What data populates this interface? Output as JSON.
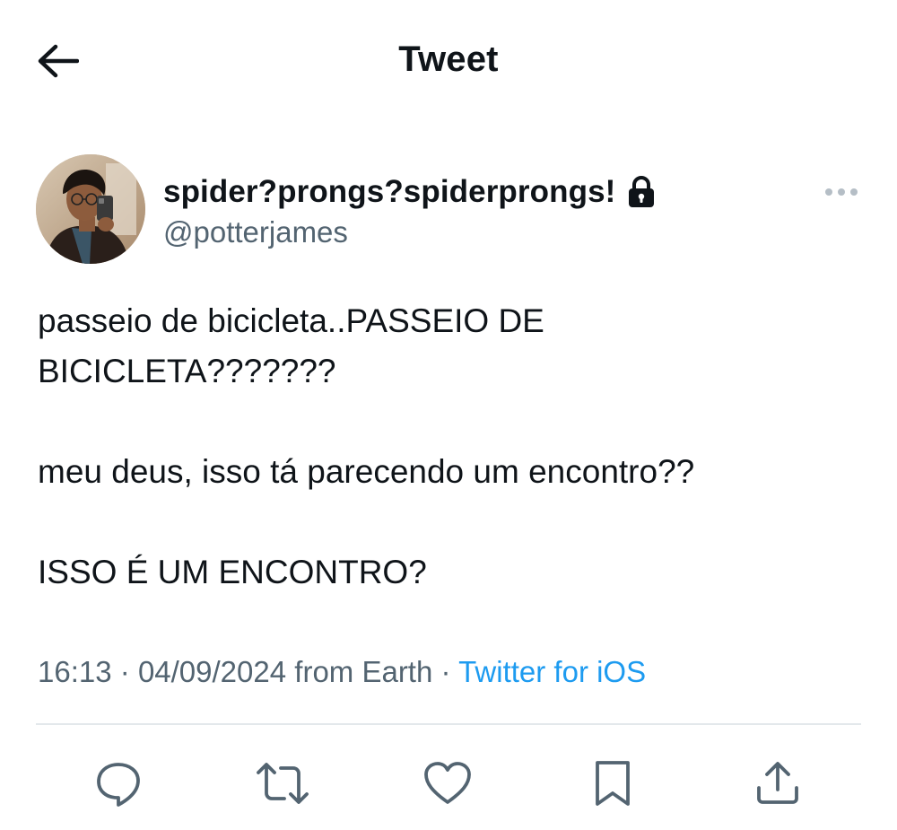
{
  "header": {
    "title": "Tweet",
    "back_icon": "arrow-left-icon"
  },
  "author": {
    "display_name": "spider?prongs?spiderprongs!",
    "handle": "@potterjames",
    "protected_icon": "lock-icon",
    "more_icon": "more-horizontal-icon"
  },
  "tweet": {
    "paragraphs": [
      "passeio de bicicleta..PASSEIO DE BICICLETA???????",
      "meu deus, isso tá parecendo um encontro??",
      "ISSO É UM ENCONTRO?"
    ]
  },
  "meta": {
    "time": "16:13",
    "separator": "·",
    "date": "04/09/2024",
    "location": "from Earth",
    "source": "Twitter for iOS"
  },
  "actions": {
    "reply_icon": "reply-icon",
    "retweet_icon": "retweet-icon",
    "like_icon": "heart-icon",
    "bookmark_icon": "bookmark-icon",
    "share_icon": "share-icon"
  },
  "colors": {
    "text": "#0f1419",
    "secondary": "#536471",
    "link": "#1d9bf0",
    "divider": "#e3e8eb"
  }
}
